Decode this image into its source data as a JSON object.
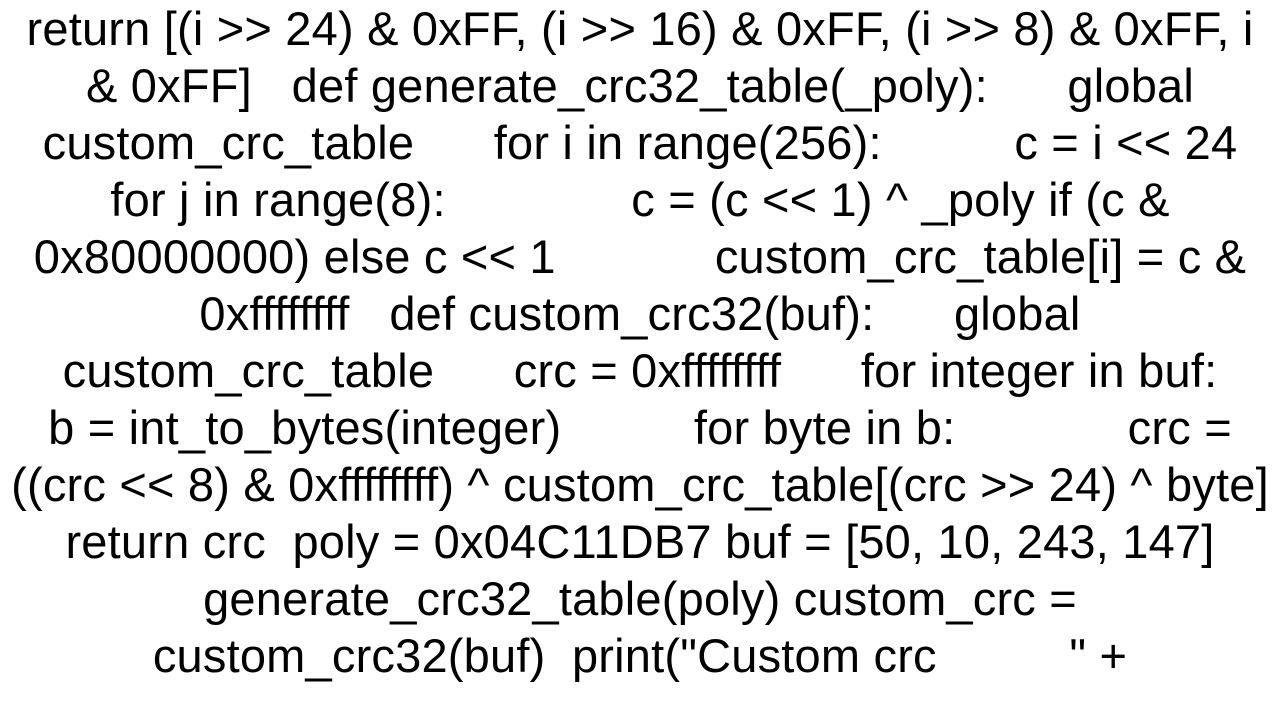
{
  "code_text": "return [(i >> 24) & 0xFF, (i >> 16) & 0xFF, (i >> 8) & 0xFF, i & 0xFF]   def generate_crc32_table(_poly):      global custom_crc_table      for i in range(256):          c = i << 24          for j in range(8):              c = (c << 1) ^ _poly if (c & 0x80000000) else c << 1            custom_crc_table[i] = c & 0xffffffff   def custom_crc32(buf):      global custom_crc_table      crc = 0xffffffff      for integer in buf:          b = int_to_bytes(integer)          for byte in b:             crc = ((crc << 8) & 0xffffffff) ^ custom_crc_table[(crc >> 24) ^ byte]      return crc  poly = 0x04C11DB7 buf = [50, 10, 243, 147]  generate_crc32_table(poly) custom_crc = custom_crc32(buf)  print(\"Custom crc          \" +"
}
